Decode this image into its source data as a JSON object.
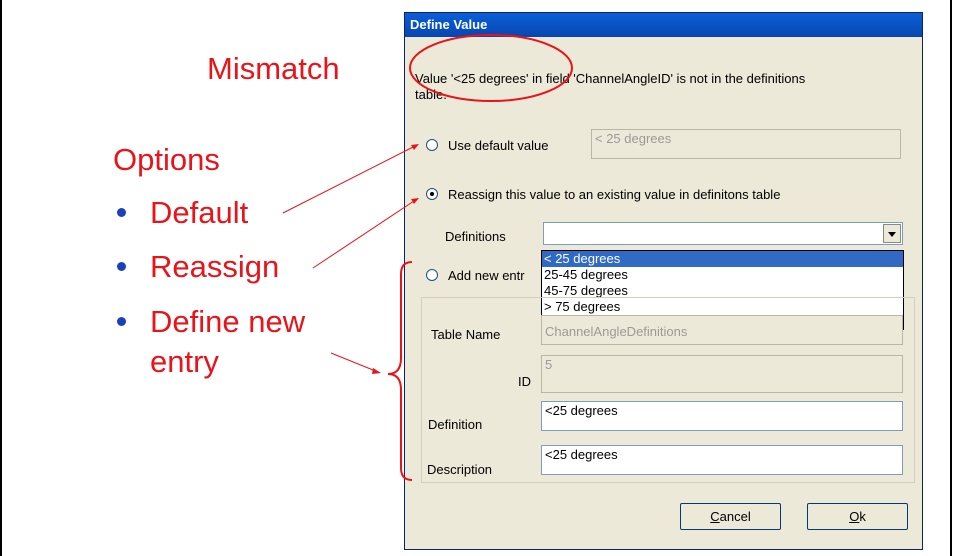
{
  "annotations": {
    "mismatch": "Mismatch",
    "options": "Options",
    "bullets": [
      "Default",
      "Reassign",
      "Define new",
      "entry"
    ]
  },
  "dialog": {
    "title": "Define Value",
    "message_line1": "Value '<25 degrees' in field 'ChannelAngleID' is not in the definitions",
    "message_line2": "table.",
    "option_default_label": "Use default value",
    "default_value": "< 25 degrees",
    "option_reassign_label": "Reassign this value to an existing value in definitons table",
    "definitions_label": "Definitions",
    "definitions_options": [
      "< 25 degrees",
      "25-45 degrees",
      "45-75 degrees",
      "> 75 degrees"
    ],
    "definitions_selected_index": 0,
    "option_add_label": "Add new entr",
    "table_name_label": "Table Name",
    "table_name_value": "ChannelAngleDefinitions",
    "id_label": "ID",
    "id_value": "5",
    "definition_label": "Definition",
    "definition_value": "<25 degrees",
    "description_label": "Description",
    "description_value": "<25 degrees",
    "cancel_label": "Cancel",
    "ok_label": "Ok",
    "selected_option": "reassign"
  },
  "colors": {
    "annotation": "#e8141a",
    "title_bar": "#0a5fd8",
    "selection": "#316ac5"
  }
}
